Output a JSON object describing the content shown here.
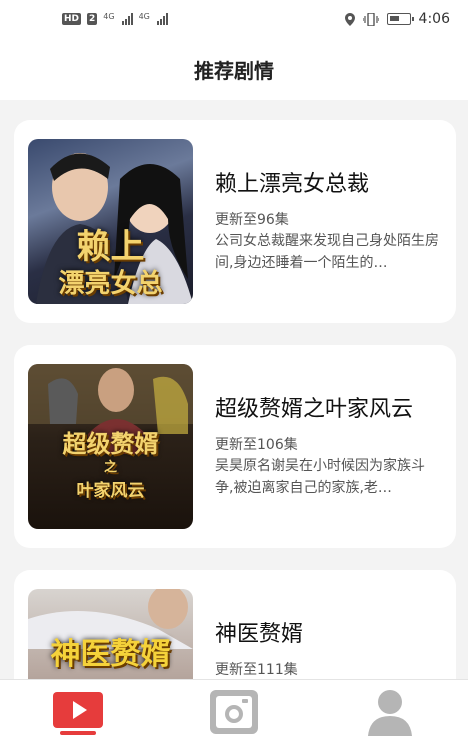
{
  "status_bar": {
    "hd": "HD",
    "sim": "2",
    "net1": "4G",
    "net2": "4G",
    "time": "4:06",
    "battery_level": 0.55
  },
  "header": {
    "title": "推荐剧情"
  },
  "dramas": [
    {
      "title": "赖上漂亮女总裁",
      "episodes": "更新至96集",
      "description": "公司女总裁醒来发现自己身处陌生房间,身边还睡着一个陌生的…",
      "cover_text": [
        "赖上",
        "漂亮女总"
      ]
    },
    {
      "title": "超级赘婿之叶家风云",
      "episodes": "更新至106集",
      "description": "吴昊原名谢吴在小时候因为家族斗争,被迫离家自己的家族,老…",
      "cover_text": [
        "超级赘婿",
        "之",
        "叶家风云"
      ]
    },
    {
      "title": "神医赘婿",
      "episodes": "更新至111集",
      "description": "",
      "cover_text": [
        "神医赘婿"
      ]
    }
  ],
  "bottom_nav": [
    {
      "name": "video-tab",
      "icon": "play-tv-icon",
      "active": true
    },
    {
      "name": "camera-tab",
      "icon": "camera-icon",
      "active": false
    },
    {
      "name": "profile-tab",
      "icon": "user-icon",
      "active": false
    }
  ],
  "colors": {
    "accent": "#e63c3c",
    "inactive_icon": "#b5b5b5"
  }
}
